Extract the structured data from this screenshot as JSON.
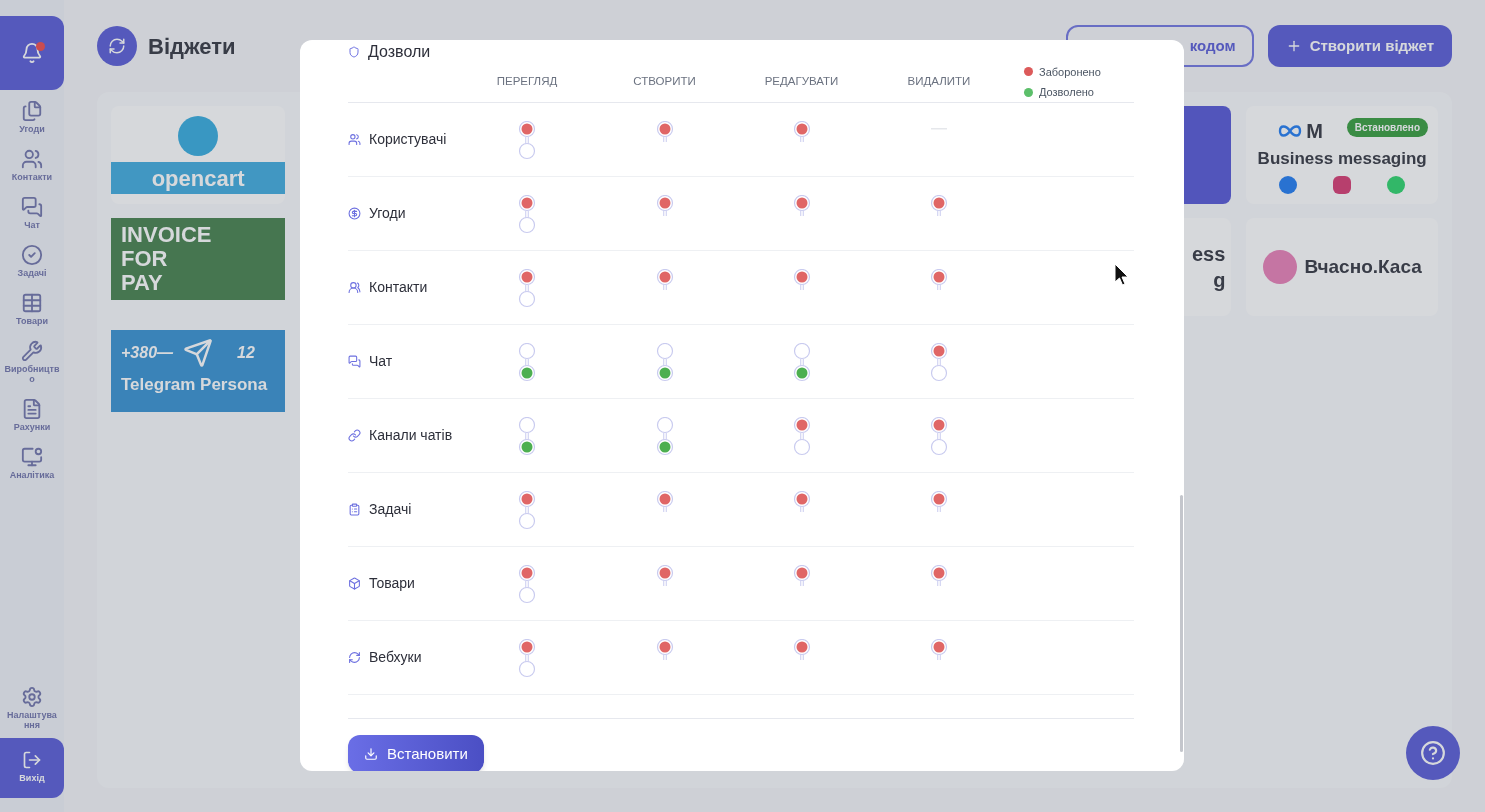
{
  "sidebar": {
    "items": [
      {
        "label": "Угоди",
        "selected": false
      },
      {
        "label": "Контакти",
        "selected": false
      },
      {
        "label": "Чат",
        "selected": false
      },
      {
        "label": "Задачі",
        "selected": false
      },
      {
        "label": "Товари",
        "selected": false
      },
      {
        "label": "Виробництво",
        "selected": false
      },
      {
        "label": "Рахунки",
        "selected": false
      },
      {
        "label": "Аналітика",
        "selected": false
      }
    ],
    "settings": "Налаштування",
    "logout": "Вихід"
  },
  "header": {
    "title": "Віджети",
    "code_button": "кодом",
    "create_button": "Створити віджет"
  },
  "widgets": {
    "opencart": "opencart",
    "invoice": [
      "INVOICE",
      "FOR",
      "PAY"
    ],
    "telegram": {
      "number": "+380—",
      "count": "12",
      "name": "Telegram Persona"
    },
    "partial": [
      "ess",
      "g"
    ],
    "meta": {
      "brand": "M",
      "name": "Business messaging",
      "badge": "Встановлено"
    },
    "vchasno": "Вчасно.Каса"
  },
  "modal": {
    "section": "Дозволи",
    "columns": [
      "ПЕРЕГЛЯД",
      "СТВОРИТИ",
      "РЕДАГУВАТИ",
      "ВИДАЛИТИ"
    ],
    "legend": [
      {
        "label": "Заборонено",
        "color": "#dc5a5a"
      },
      {
        "label": "Дозволено",
        "color": "#5cbf6a"
      }
    ],
    "rows": [
      {
        "label": "Користувачі",
        "cells": [
          {
            "disabled": false,
            "allowed": false,
            "expanded": true
          },
          {
            "disabled": false,
            "allowed": false,
            "expanded": false
          },
          {
            "disabled": false,
            "allowed": false,
            "expanded": false
          },
          {
            "disabled": true
          }
        ]
      },
      {
        "label": "Угоди",
        "cells": [
          {
            "disabled": false,
            "allowed": false,
            "expanded": true
          },
          {
            "disabled": false,
            "allowed": false,
            "expanded": false
          },
          {
            "disabled": false,
            "allowed": false,
            "expanded": false
          },
          {
            "disabled": false,
            "allowed": false,
            "expanded": false
          }
        ]
      },
      {
        "label": "Контакти",
        "cells": [
          {
            "disabled": false,
            "allowed": false,
            "expanded": true
          },
          {
            "disabled": false,
            "allowed": false,
            "expanded": false
          },
          {
            "disabled": false,
            "allowed": false,
            "expanded": false
          },
          {
            "disabled": false,
            "allowed": false,
            "expanded": false
          }
        ]
      },
      {
        "label": "Чат",
        "cells": [
          {
            "disabled": false,
            "allowed": true,
            "expanded": true
          },
          {
            "disabled": false,
            "allowed": true,
            "expanded": true
          },
          {
            "disabled": false,
            "allowed": true,
            "expanded": true
          },
          {
            "disabled": false,
            "allowed": false,
            "expanded": true
          }
        ]
      },
      {
        "label": "Канали чатів",
        "cells": [
          {
            "disabled": false,
            "allowed": true,
            "expanded": true
          },
          {
            "disabled": false,
            "allowed": true,
            "expanded": true
          },
          {
            "disabled": false,
            "allowed": false,
            "expanded": true
          },
          {
            "disabled": false,
            "allowed": false,
            "expanded": true
          }
        ]
      },
      {
        "label": "Задачі",
        "cells": [
          {
            "disabled": false,
            "allowed": false,
            "expanded": true
          },
          {
            "disabled": false,
            "allowed": false,
            "expanded": false
          },
          {
            "disabled": false,
            "allowed": false,
            "expanded": false
          },
          {
            "disabled": false,
            "allowed": false,
            "expanded": false
          }
        ]
      },
      {
        "label": "Товари",
        "cells": [
          {
            "disabled": false,
            "allowed": false,
            "expanded": true
          },
          {
            "disabled": false,
            "allowed": false,
            "expanded": false
          },
          {
            "disabled": false,
            "allowed": false,
            "expanded": false
          },
          {
            "disabled": false,
            "allowed": false,
            "expanded": false
          }
        ]
      },
      {
        "label": "Вебхуки",
        "cells": [
          {
            "disabled": false,
            "allowed": false,
            "expanded": true
          },
          {
            "disabled": false,
            "allowed": false,
            "expanded": false
          },
          {
            "disabled": false,
            "allowed": false,
            "expanded": false
          },
          {
            "disabled": false,
            "allowed": false,
            "expanded": false
          }
        ]
      }
    ],
    "install_button": "Встановити"
  }
}
